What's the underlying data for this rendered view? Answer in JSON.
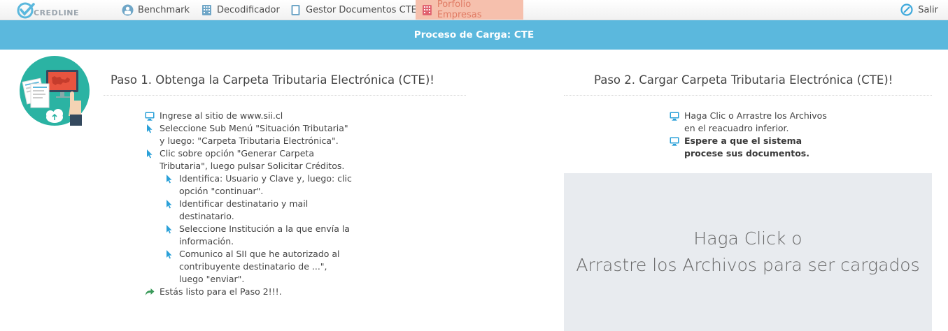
{
  "app": {
    "logo_text": "CREDLINE"
  },
  "nav": {
    "items": [
      {
        "label": "Benchmark",
        "icon": "user-chart-icon",
        "active": false
      },
      {
        "label": "Decodificador",
        "icon": "building-icon",
        "active": false
      },
      {
        "label": "Gestor Documentos CTE",
        "icon": "document-icon",
        "active": false
      },
      {
        "label": "Porfolio Empresas",
        "icon": "building-icon",
        "active": true
      }
    ],
    "logout_label": "Salir"
  },
  "banner": {
    "title": "Proceso de Carga: CTE"
  },
  "step1": {
    "title": "Paso 1. Obtenga la Carpeta Tributaria Electrónica (CTE)!",
    "items": [
      {
        "icon": "monitor-icon",
        "text": "Ingrese al sitio de www.sii.cl"
      },
      {
        "icon": "cursor-icon",
        "text": "Seleccione Sub Menú \"Situación Tributaria\" y luego: \"Carpeta Tributaria Electrónica\"."
      },
      {
        "icon": "cursor-icon",
        "text": "Clic sobre opción \"Generar Carpeta Tributaria\", luego pulsar Solicitar Créditos."
      },
      {
        "icon": "cursor-icon",
        "text": "Identifica: Usuario y Clave y, luego: clic opción \"continuar\".",
        "sub": true
      },
      {
        "icon": "cursor-icon",
        "text": "Identificar destinatario y mail destinatario.",
        "sub": true
      },
      {
        "icon": "cursor-icon",
        "text": "Seleccione Institución a la que envía la información.",
        "sub": true
      },
      {
        "icon": "cursor-icon",
        "text": "Comunico al SII que he autorizado al contribuyente destinatario de ...\", luego \"enviar\".",
        "sub": true
      },
      {
        "icon": "share-arrow-icon",
        "text": "Estás listo para el Paso 2!!!."
      }
    ]
  },
  "step2": {
    "title": "Paso 2. Cargar Carpeta Tributaria Electrónica (CTE)!",
    "items": [
      {
        "icon": "monitor-icon",
        "text": "Haga Clic o Arrastre los Archivos en el reacuadro inferior.",
        "bold": false
      },
      {
        "icon": "monitor-icon",
        "text": "Espere a que el sistema procese sus documentos.",
        "bold": true
      }
    ]
  },
  "dropzone": {
    "line1": "Haga Click o",
    "line2": "Arrastre los Archivos para ser cargados"
  },
  "colors": {
    "banner": "#5bb8dd",
    "active_tab_bg": "#f6c0ad",
    "active_tab_text": "#e07b64",
    "icon_blue": "#2aa0d8",
    "dropzone_bg": "#e8ebef"
  }
}
